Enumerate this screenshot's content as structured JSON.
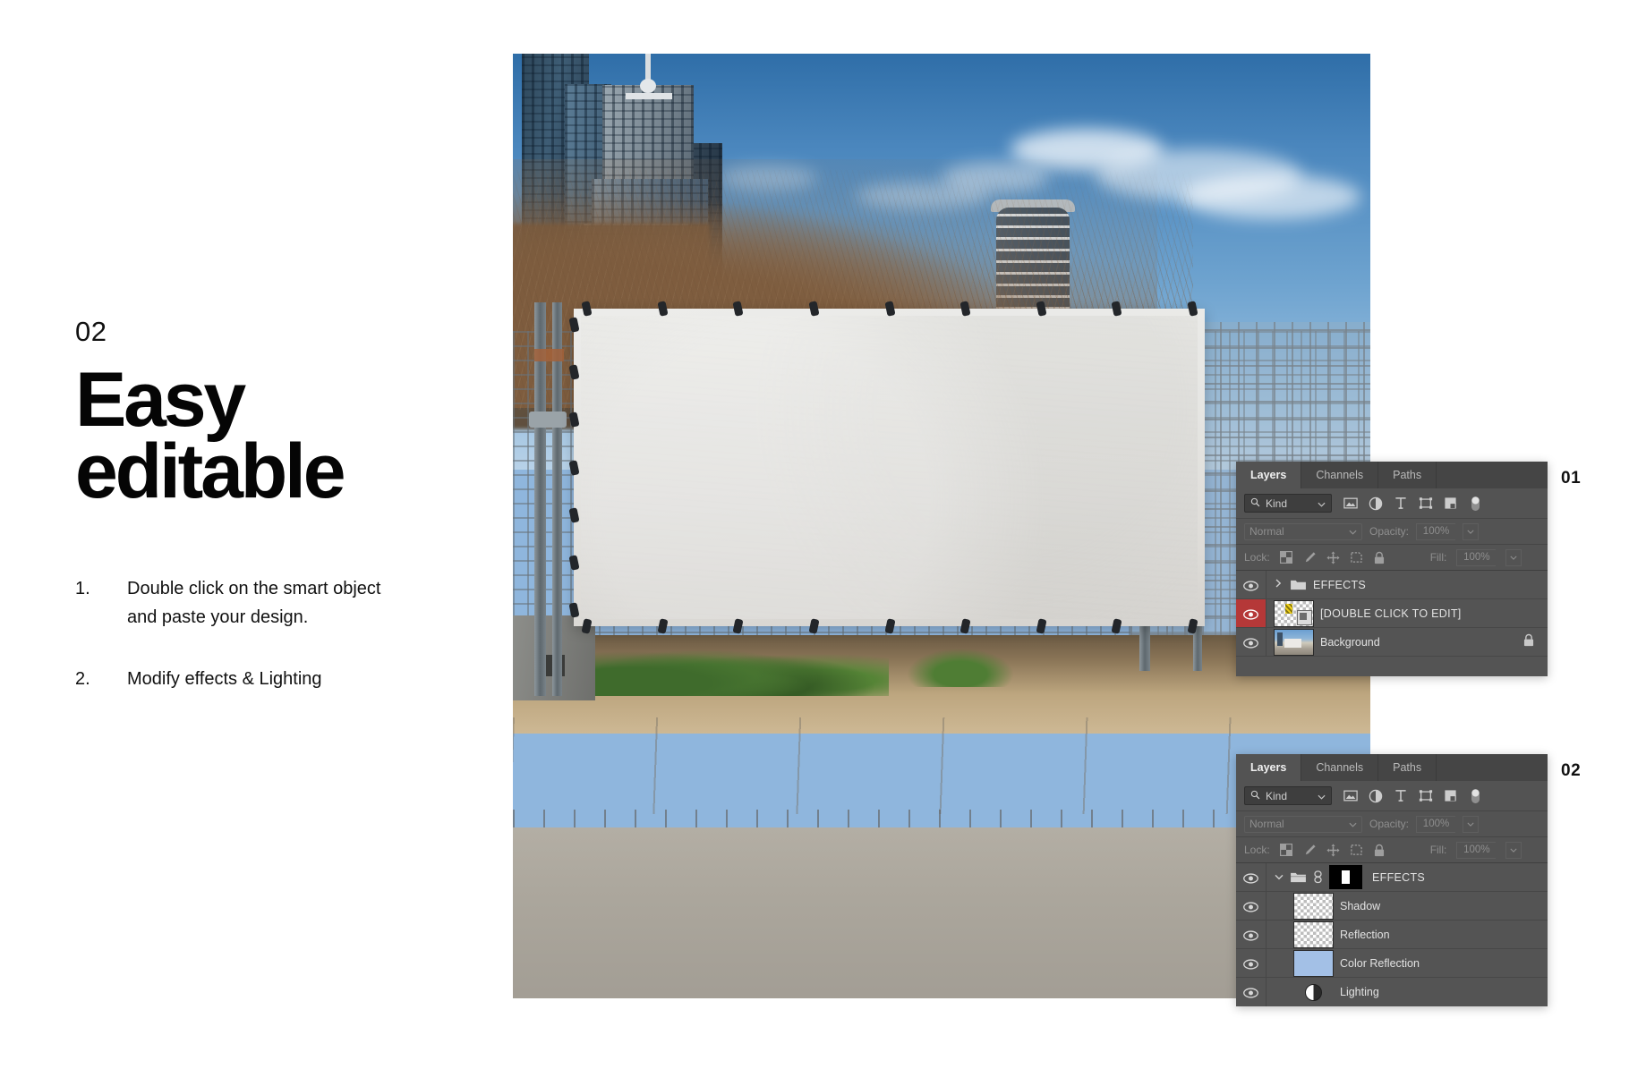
{
  "left": {
    "kicker": "02",
    "headline_line1": "Easy",
    "headline_line2": "editable",
    "steps": [
      {
        "num": "1.",
        "text": "Double click on the smart object and paste your design."
      },
      {
        "num": "2.",
        "text": "Modify effects & Lighting"
      }
    ]
  },
  "markers": {
    "panel1": "01",
    "panel2": "02"
  },
  "panel1": {
    "tabs": [
      {
        "label": "Layers",
        "active": true
      },
      {
        "label": "Channels",
        "active": false
      },
      {
        "label": "Paths",
        "active": false
      }
    ],
    "filter": {
      "kind_label": "Kind",
      "search_icon": "search-icon",
      "chevron": "chevron-down-icon",
      "type_icons": [
        "pixel-layer-icon",
        "adjustment-layer-icon",
        "type-layer-icon",
        "shape-layer-icon",
        "smart-object-icon",
        "filter-toggle-icon"
      ]
    },
    "blend": {
      "mode": "Normal",
      "opacity_label": "Opacity:",
      "opacity_value": "100%"
    },
    "lock": {
      "label": "Lock:",
      "icons": [
        "lock-transparent-pixels-icon",
        "lock-image-pixels-icon",
        "lock-position-icon",
        "lock-artboard-nesting-icon",
        "lock-all-icon"
      ],
      "fill_label": "Fill:",
      "fill_value": "100%"
    },
    "layers": [
      {
        "name": "EFFECTS",
        "type": "group",
        "visible": true,
        "selected": false,
        "collapsed": true,
        "locked": false
      },
      {
        "name": "[DOUBLE CLICK TO EDIT]",
        "type": "smart-object",
        "visible": true,
        "selected": true,
        "locked": false
      },
      {
        "name": "Background",
        "type": "image",
        "visible": true,
        "selected": false,
        "locked": true
      }
    ]
  },
  "panel2": {
    "tabs": [
      {
        "label": "Layers",
        "active": true
      },
      {
        "label": "Channels",
        "active": false
      },
      {
        "label": "Paths",
        "active": false
      }
    ],
    "filter": {
      "kind_label": "Kind",
      "search_icon": "search-icon",
      "chevron": "chevron-down-icon",
      "type_icons": [
        "pixel-layer-icon",
        "adjustment-layer-icon",
        "type-layer-icon",
        "shape-layer-icon",
        "smart-object-icon",
        "filter-toggle-icon"
      ]
    },
    "blend": {
      "mode": "Normal",
      "opacity_label": "Opacity:",
      "opacity_value": "100%"
    },
    "lock": {
      "label": "Lock:",
      "icons": [
        "lock-transparent-pixels-icon",
        "lock-image-pixels-icon",
        "lock-position-icon",
        "lock-artboard-nesting-icon",
        "lock-all-icon"
      ],
      "fill_label": "Fill:",
      "fill_value": "100%"
    },
    "layers": [
      {
        "name": "EFFECTS",
        "type": "group",
        "visible": true,
        "expanded": true,
        "masked": true,
        "linked": true
      },
      {
        "name": "Shadow",
        "type": "transparent",
        "visible": true
      },
      {
        "name": "Reflection",
        "type": "transparent",
        "visible": true
      },
      {
        "name": "Color Reflection",
        "type": "solid",
        "visible": true,
        "color": "#a3c0e6"
      },
      {
        "name": "Lighting",
        "type": "adjustment",
        "visible": true
      }
    ]
  },
  "colors": {
    "panel_bg": "#535353",
    "panel_row": "#545454",
    "panel_tabbar": "#454545",
    "selected_eye": "#b53838",
    "text": "#e2e2e2",
    "muted_text": "#8e8e8e",
    "page_bg": "#ffffff",
    "headline": "#050505"
  }
}
